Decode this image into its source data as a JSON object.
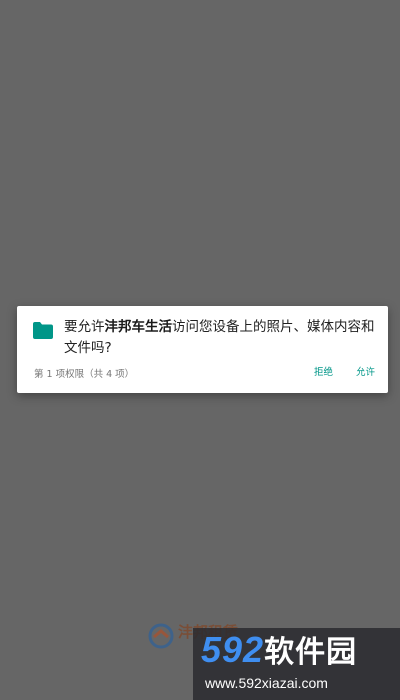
{
  "dialog": {
    "icon": "folder-icon",
    "message_prefix": "要允许",
    "app_name": "沣邦车生活",
    "message_suffix": "访问您设备上的照片、媒体内容和文件吗?",
    "counter": "第 1 项权限（共 4 项）",
    "deny_label": "拒绝",
    "allow_label": "允许"
  },
  "splash": {
    "brand": "沣邦租赁"
  },
  "watermark": {
    "number": "592",
    "text": "软件园",
    "url": "www.592xiazai.com"
  },
  "colors": {
    "scrim": "#666666",
    "accent": "#009688",
    "watermark_blue": "#3f8ef0"
  }
}
